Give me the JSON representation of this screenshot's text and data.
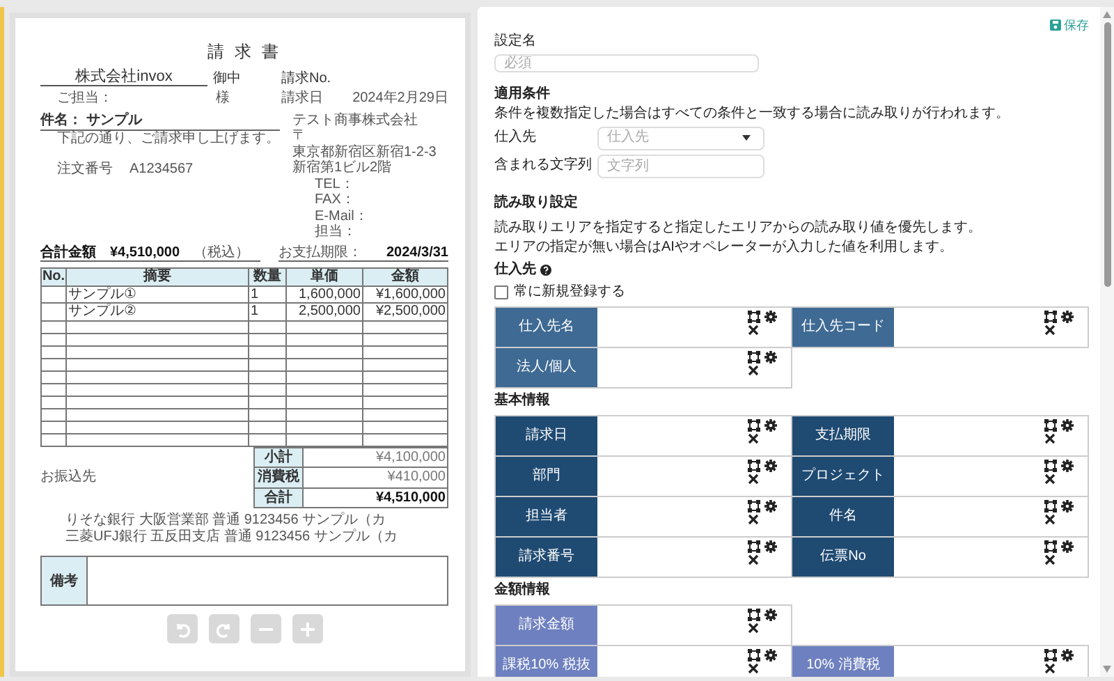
{
  "invoice": {
    "title": "請 求 書",
    "recipient": "株式会社invox",
    "honorific": "御中",
    "contact_label": "ご担当：",
    "contact_suffix": "様",
    "invoice_no_label": "請求No.",
    "date_label": "請求日",
    "date": "2024年2月29日",
    "subject": "件名： サンプル",
    "greeting": "下記の通り、ご請求申し上げます。",
    "order_label": "注文番号",
    "order_no": "A1234567",
    "issuer": [
      "テスト商事株式会社",
      "〒",
      "東京都新宿区新宿1-2-3",
      "新宿第1ビル2階"
    ],
    "contact_fields": [
      "TEL：",
      "FAX：",
      "E-Mail：",
      "担当："
    ],
    "total_label": "合計金額",
    "total": "¥4,510,000",
    "tax_note": "（税込）",
    "due_label": "お支払期限：",
    "due": "2024/3/31",
    "columns": [
      "No.",
      "摘要",
      "数量",
      "単価",
      "金額"
    ],
    "rows": [
      {
        "description": "サンプル①",
        "qty": "1",
        "unit_price": "1,600,000",
        "amount": "¥1,600,000"
      },
      {
        "description": "サンプル②",
        "qty": "1",
        "unit_price": "2,500,000",
        "amount": "¥2,500,000"
      }
    ],
    "summary": [
      {
        "kind": "line",
        "label": "小計",
        "value": "¥4,100,000"
      },
      {
        "kind": "line",
        "label": "消費税",
        "value": "¥410,000"
      },
      {
        "kind": "total",
        "label": "合計",
        "value": "¥4,510,000"
      }
    ],
    "bank_label": "お振込先",
    "banks": [
      "りそな銀行 大阪営業部 普通 9123456 サンプル（カ",
      "三菱UFJ銀行 五反田支店 普通 9123456 サンプル（カ"
    ],
    "remarks_label": "備考"
  },
  "toolbar": [
    {
      "kind": "undo",
      "disabled": true
    },
    {
      "kind": "redo",
      "disabled": true
    },
    {
      "kind": "zoom-out",
      "disabled": true
    },
    {
      "kind": "zoom-in",
      "disabled": true
    }
  ],
  "settings": {
    "save": "保存",
    "name_label": "設定名",
    "name_placeholder": "必須",
    "conditions": {
      "title": "適用条件",
      "note": "条件を複数指定した場合はすべての条件と一致する場合に読み取りが行われます。",
      "supplier_label": "仕入先",
      "supplier_placeholder": "仕入先",
      "text_label": "含まれる文字列",
      "text_placeholder": "文字列"
    },
    "reading": {
      "title": "読み取り設定",
      "notes": [
        "読み取りエリアを指定すると指定したエリアからの読み取り値を優先します。",
        "エリアの指定が無い場合はAIやオペレーターが入力した値を利用します。"
      ]
    },
    "groups": [
      {
        "title": "仕入先",
        "help": true,
        "checkbox": {
          "label": "常に新規登録する",
          "checked": false
        },
        "color": "#3e6a94",
        "rows": [
          [
            "仕入先名",
            "仕入先コード"
          ],
          [
            "法人/個人"
          ]
        ]
      },
      {
        "title": "基本情報",
        "help": false,
        "color": "#1f4a72",
        "rows": [
          [
            "請求日",
            "支払期限"
          ],
          [
            "部門",
            "プロジェクト"
          ],
          [
            "担当者",
            "件名"
          ],
          [
            "請求番号",
            "伝票No"
          ]
        ]
      },
      {
        "title": "金額情報",
        "help": false,
        "color": "#6e80bf",
        "rows": [
          [
            "請求金額"
          ],
          [
            "課税10% 税抜",
            "10% 消費税"
          ]
        ]
      }
    ]
  }
}
